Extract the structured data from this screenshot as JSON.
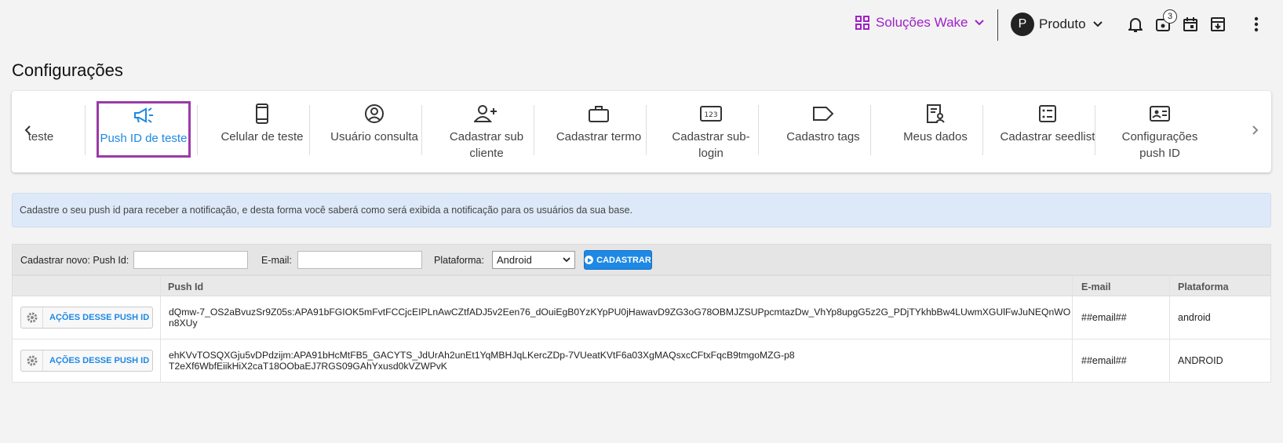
{
  "topbar": {
    "brand": "Soluções Wake",
    "avatar_letter": "P",
    "user": "Produto",
    "badge_count": "3",
    "brand_color": "#a020c8"
  },
  "page": {
    "title": "Configurações"
  },
  "carousel": {
    "items": [
      {
        "label": "teste",
        "icon": ""
      },
      {
        "label": "Push ID de teste",
        "icon": "megaphone-icon",
        "active": true
      },
      {
        "label": "Celular de teste",
        "icon": "phone-icon"
      },
      {
        "label": "Usuário consulta",
        "icon": "user-circle-icon"
      },
      {
        "label": "Cadastrar sub cliente",
        "icon": "user-add-icon"
      },
      {
        "label": "Cadastrar termo",
        "icon": "briefcase-icon"
      },
      {
        "label": "Cadastrar sub-login",
        "icon": "numbers-icon"
      },
      {
        "label": "Cadastro tags",
        "icon": "tag-icon"
      },
      {
        "label": "Meus dados",
        "icon": "user-data-icon"
      },
      {
        "label": "Cadastrar seedlist",
        "icon": "list-icon"
      },
      {
        "label": "Configurações push ID",
        "icon": "id-card-icon"
      }
    ],
    "numbers_glyph": "123"
  },
  "info": {
    "text": "Cadastre o seu push id para receber a notificação, e desta forma você saberá como será exibida a notificação para os usuários da sua base."
  },
  "form": {
    "pushid_label": "Cadastrar novo: Push Id:",
    "email_label": "E-mail:",
    "platform_label": "Plataforma:",
    "platform_value": "Android",
    "submit_label": "CADASTRAR"
  },
  "table": {
    "headers": {
      "pushid": "Push Id",
      "email": "E-mail",
      "platform": "Plataforma"
    },
    "action_label": "AÇÕES DESSE PUSH ID",
    "rows": [
      {
        "pushid": "dQmw-7_OS2aBvuzSr9Z05s:APA91bFGIOK5mFvtFCCjcEIPLnAwCZtfADJ5v2Een76_dOuiEgB0YzKYpPU0jHawavD9ZG3oG78OBMJZSUPpcmtazDw_VhYp8upgG5z2G_PDjTYkhbBw4LUwmXGUlFwJuNEQnWOn8XUy",
        "email": "##email##",
        "platform": "android"
      },
      {
        "pushid": "ehKVvTOSQXGju5vDPdzijm:APA91bHcMtFB5_GACYTS_JdUrAh2unEt1YqMBHJqLKercZDp-7VUeatKVtF6a03XgMAQsxcCFtxFqcB9tmgoMZG-p8T2eXf6WbfEiikHiX2caT18OObaEJ7RGS09GAhYxusd0kVZWPvK",
        "email": "##email##",
        "platform": "ANDROID"
      }
    ]
  }
}
